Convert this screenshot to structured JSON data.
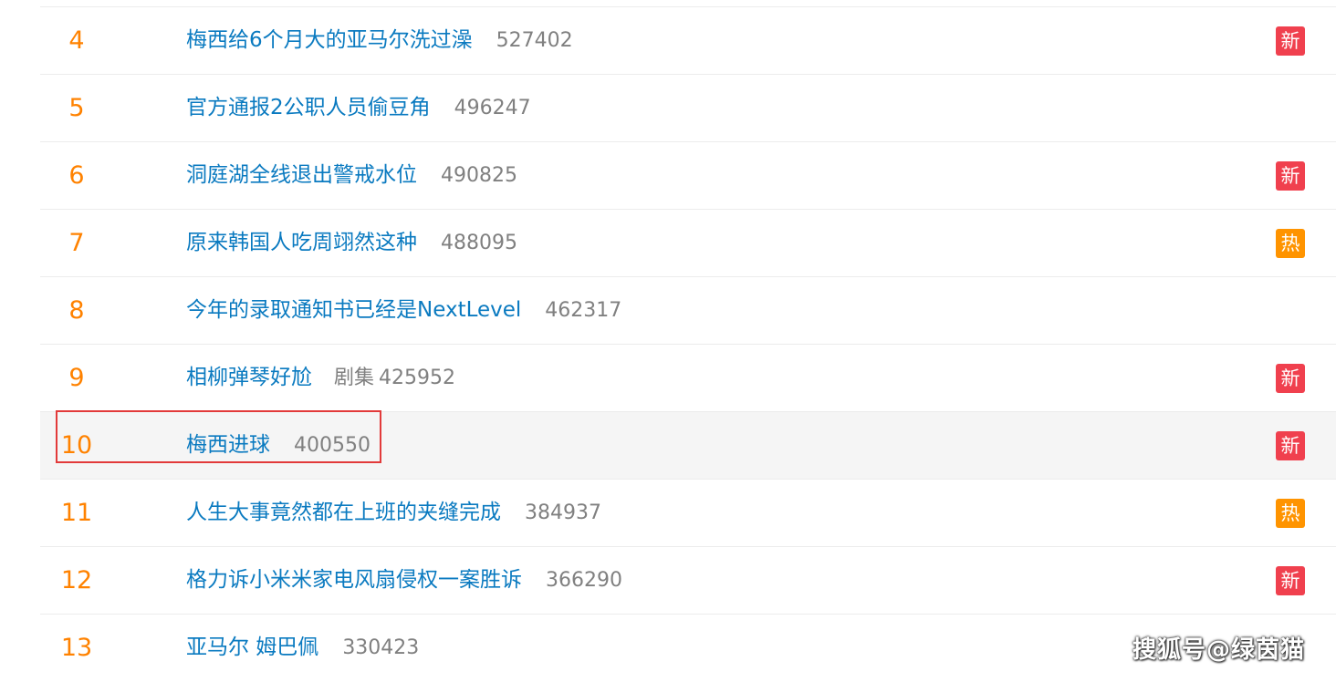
{
  "colors": {
    "rank": "#ff8200",
    "topic": "#0a7ac0",
    "count": "#808080",
    "badge_new": "#f0404e",
    "badge_hot": "#ff9400",
    "highlight_border": "#e23a3a"
  },
  "rows": [
    {
      "rank": "4",
      "topic": "梅西给6个月大的亚马尔洗过澡",
      "label": "",
      "count": "527402",
      "badge": "新",
      "badge_type": "new"
    },
    {
      "rank": "5",
      "topic": "官方通报2公职人员偷豆角",
      "label": "",
      "count": "496247",
      "badge": "",
      "badge_type": ""
    },
    {
      "rank": "6",
      "topic": "洞庭湖全线退出警戒水位",
      "label": "",
      "count": "490825",
      "badge": "新",
      "badge_type": "new"
    },
    {
      "rank": "7",
      "topic": "原来韩国人吃周翊然这种",
      "label": "",
      "count": "488095",
      "badge": "热",
      "badge_type": "hot"
    },
    {
      "rank": "8",
      "topic": "今年的录取通知书已经是NextLevel",
      "label": "",
      "count": "462317",
      "badge": "",
      "badge_type": ""
    },
    {
      "rank": "9",
      "topic": "相柳弹琴好尬",
      "label": "剧集",
      "count": "425952",
      "badge": "新",
      "badge_type": "new"
    },
    {
      "rank": "10",
      "topic": "梅西进球",
      "label": "",
      "count": "400550",
      "badge": "新",
      "badge_type": "new"
    },
    {
      "rank": "11",
      "topic": "人生大事竟然都在上班的夹缝完成",
      "label": "",
      "count": "384937",
      "badge": "热",
      "badge_type": "hot"
    },
    {
      "rank": "12",
      "topic": "格力诉小米米家电风扇侵权一案胜诉",
      "label": "",
      "count": "366290",
      "badge": "新",
      "badge_type": "new"
    },
    {
      "rank": "13",
      "topic": "亚马尔 姆巴佩",
      "label": "",
      "count": "330423",
      "badge": "",
      "badge_type": ""
    }
  ],
  "watermark": "搜狐号@绿茵猫"
}
